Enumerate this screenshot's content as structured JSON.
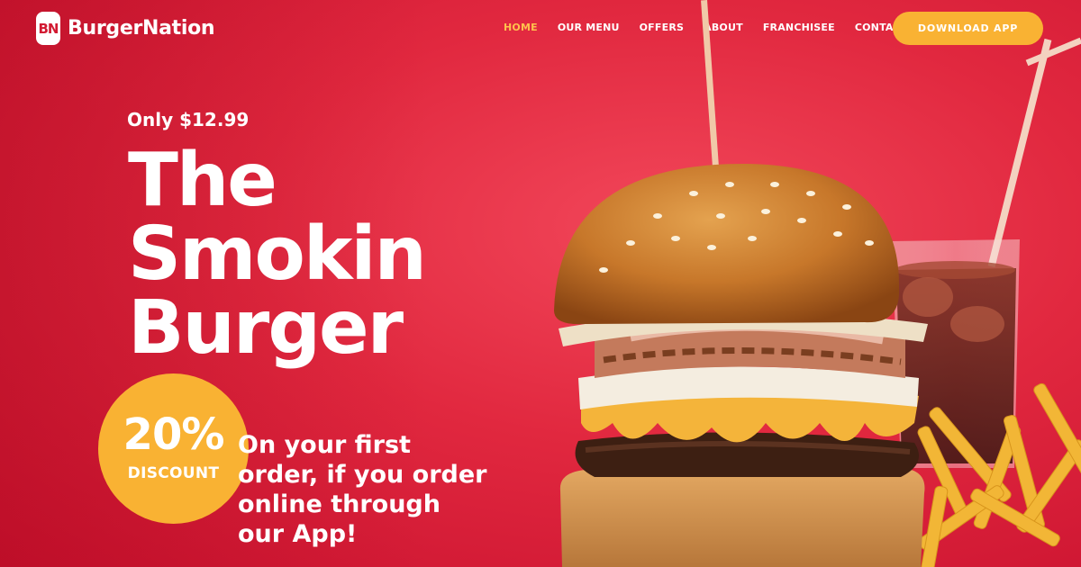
{
  "brand": {
    "mark": "BN",
    "name": "BurgerNation"
  },
  "nav": {
    "items": [
      {
        "label": "HOME",
        "active": true
      },
      {
        "label": "OUR MENU",
        "active": false
      },
      {
        "label": "OFFERS",
        "active": false
      },
      {
        "label": "ABOUT",
        "active": false
      },
      {
        "label": "FRANCHISEE",
        "active": false
      },
      {
        "label": "CONTACT",
        "active": false
      }
    ],
    "cta_label": "DOWNLOAD APP"
  },
  "hero": {
    "price": "Only $12.99",
    "headline": [
      "The",
      "Smokin",
      "Burger"
    ],
    "badge": {
      "value": "20%",
      "label": "DISCOUNT"
    },
    "promo_lines": [
      "On your first",
      "order, if you order",
      "online through",
      "our App!"
    ]
  },
  "colors": {
    "primary_red": "#e1283f",
    "accent_orange": "#f9b233",
    "active_nav": "#ffc14d",
    "text": "#ffffff"
  }
}
